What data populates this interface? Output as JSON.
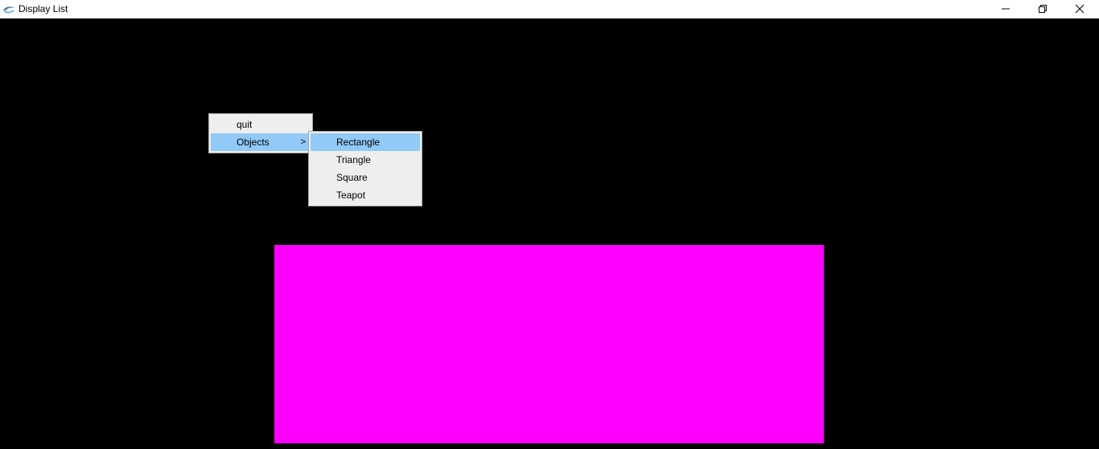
{
  "window": {
    "title": "Display List",
    "icon": "app-swirl-icon",
    "controls": [
      "minimize-icon",
      "restore-icon",
      "close-icon"
    ]
  },
  "canvas": {
    "background": "#000000",
    "shape": {
      "name": "Rectangle",
      "color": "#ff00ff"
    }
  },
  "context_menu": {
    "items": [
      {
        "label": "quit"
      },
      {
        "label": "Objects",
        "submenu_arrow": ">",
        "highlighted": true
      }
    ],
    "submenu": {
      "items": [
        {
          "label": "Rectangle",
          "highlighted": true
        },
        {
          "label": "Triangle"
        },
        {
          "label": "Square"
        },
        {
          "label": "Teapot"
        }
      ]
    },
    "highlight_color": "#91c9f7",
    "background": "#eeeeee"
  }
}
